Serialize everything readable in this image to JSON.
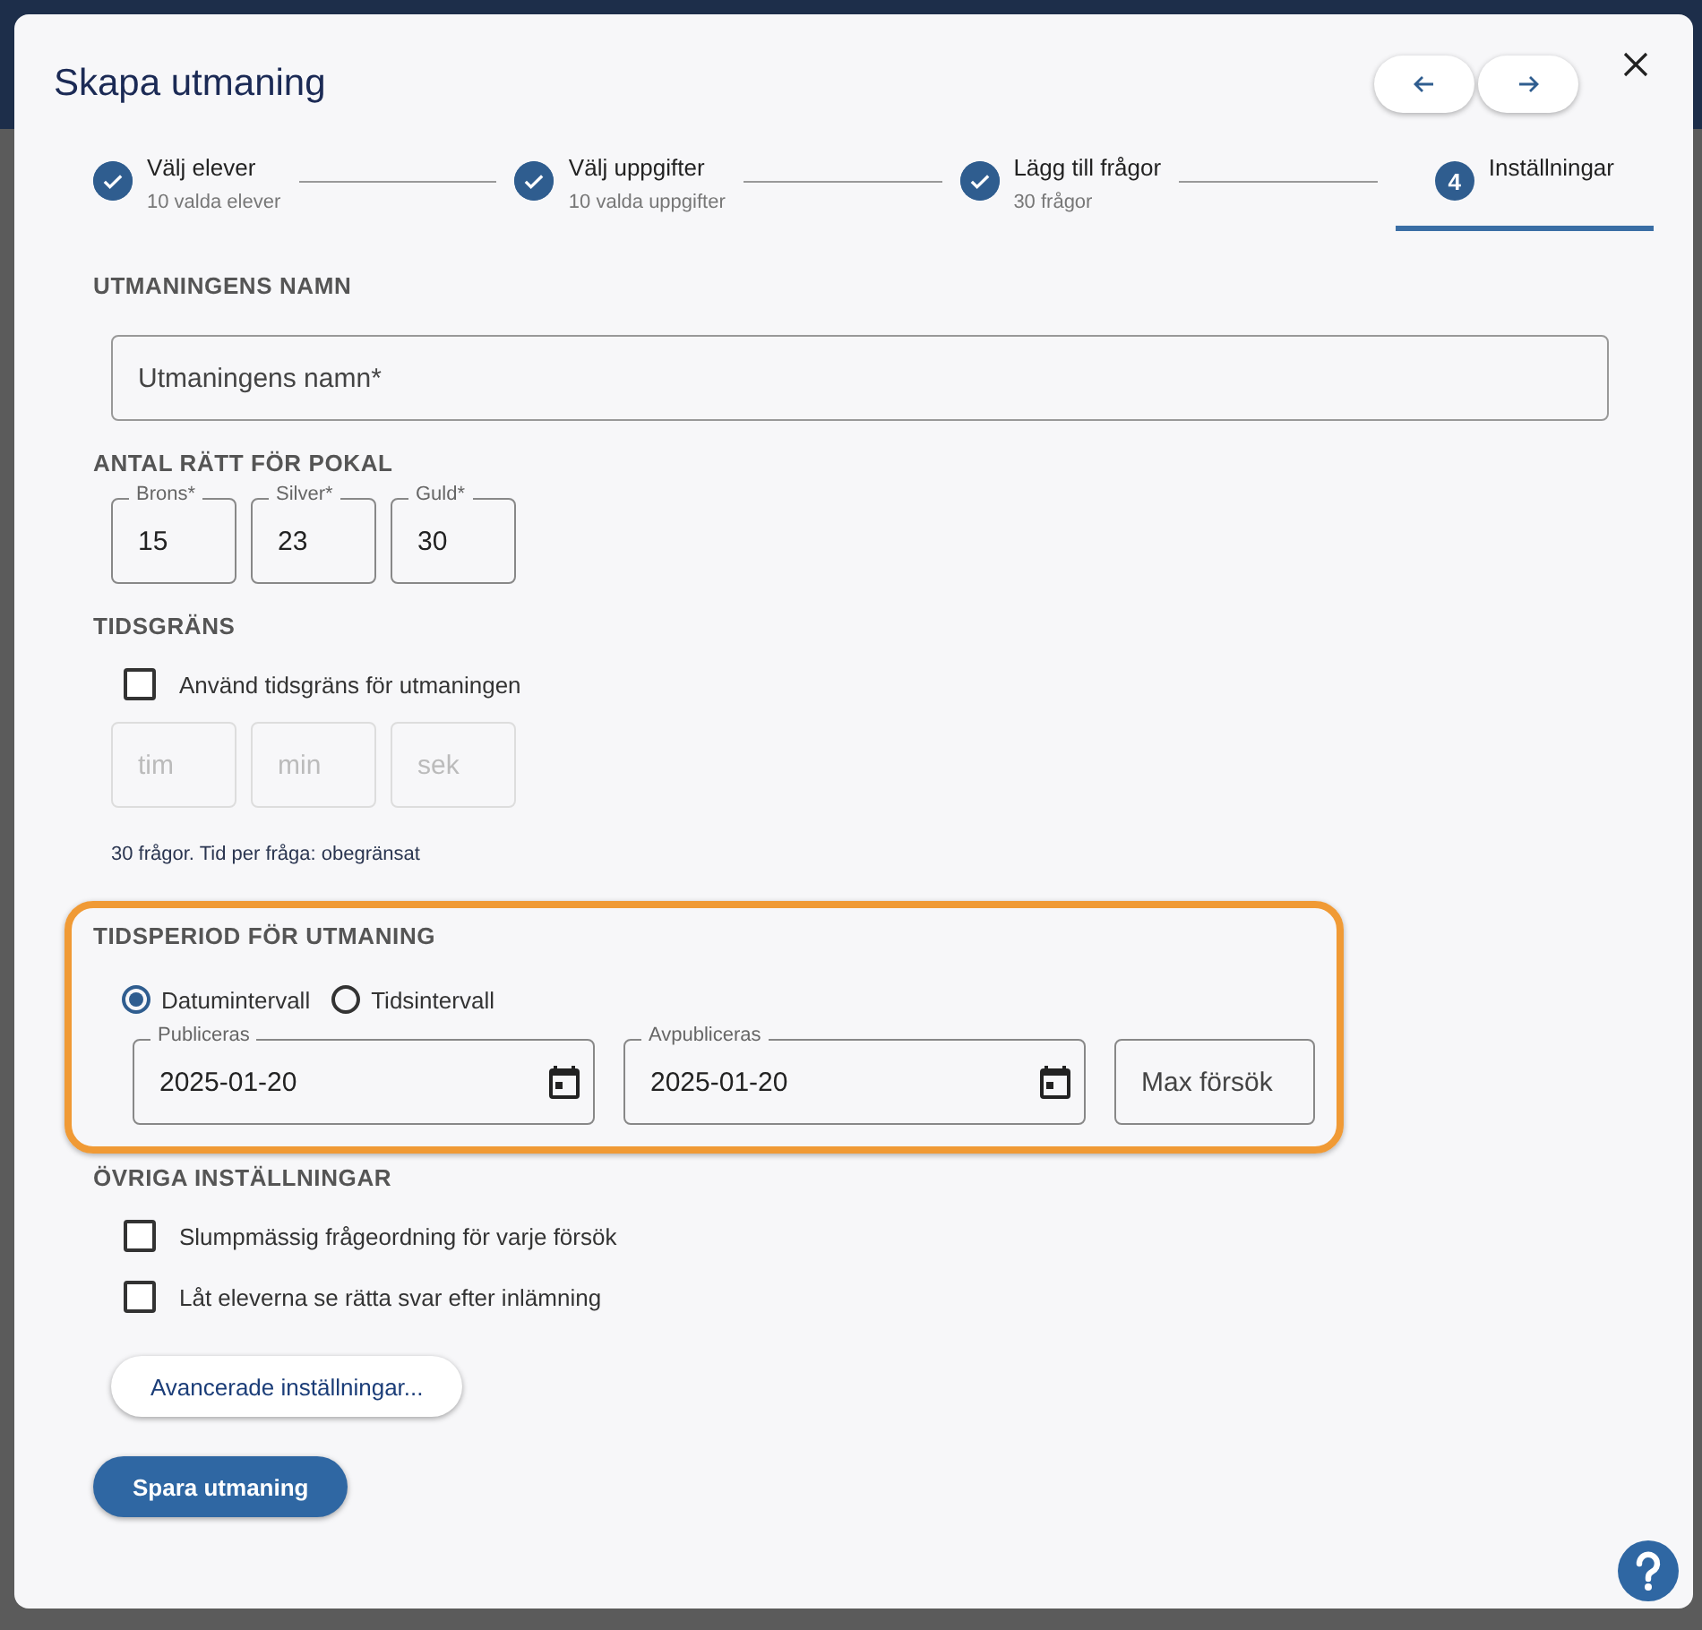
{
  "dialog": {
    "title": "Skapa utmaning",
    "nav_buttons": [
      {
        "kind": "back"
      },
      {
        "kind": "forward"
      }
    ]
  },
  "stepper": [
    {
      "title": "Välj elever",
      "subtitle": "10 valda elever",
      "completed": true,
      "selected": false
    },
    {
      "title": "Välj uppgifter",
      "subtitle": "10 valda uppgifter",
      "completed": true,
      "selected": false
    },
    {
      "title": "Lägg till frågor",
      "subtitle": "30 frågor",
      "completed": true,
      "selected": false
    },
    {
      "title": "Inställningar",
      "number": "4",
      "completed": false,
      "selected": true
    }
  ],
  "name_section": {
    "heading": "UTMANINGENS NAMN",
    "placeholder": "Utmaningens namn*"
  },
  "trophy_section": {
    "heading": "ANTAL RÄTT FÖR POKAL",
    "fields": [
      {
        "label": "Brons*",
        "value": "15"
      },
      {
        "label": "Silver*",
        "value": "23"
      },
      {
        "label": "Guld*",
        "value": "30"
      }
    ]
  },
  "time_limit_section": {
    "heading": "TIDSGRÄNS",
    "checkbox": {
      "label": "Använd tidsgräns för utmaningen",
      "checked": false
    },
    "fields": [
      {
        "placeholder": "tim",
        "disabled": true
      },
      {
        "placeholder": "min",
        "disabled": true
      },
      {
        "placeholder": "sek",
        "disabled": true
      }
    ],
    "note": "30 frågor. Tid per fråga: obegränsat"
  },
  "period_section": {
    "heading": "TIDSPERIOD FÖR UTMANING",
    "highlighted": true,
    "radios": [
      {
        "label": "Datumintervall",
        "selected": true
      },
      {
        "label": "Tidsintervall",
        "selected": false
      }
    ],
    "dates": [
      {
        "label": "Publiceras",
        "value": "2025-01-20"
      },
      {
        "label": "Avpubliceras",
        "value": "2025-01-20"
      }
    ],
    "attempts": {
      "placeholder": "Max försök"
    }
  },
  "other_section": {
    "heading": "ÖVRIGA INSTÄLLNINGAR",
    "checkboxes": [
      {
        "label": "Slumpmässig frågeordning för varje försök",
        "checked": false
      },
      {
        "label": "Låt eleverna se rätta svar efter inlämning",
        "checked": false
      }
    ]
  },
  "advanced_button": "Avancerade inställningar...",
  "save_button": "Spara utmaning"
}
